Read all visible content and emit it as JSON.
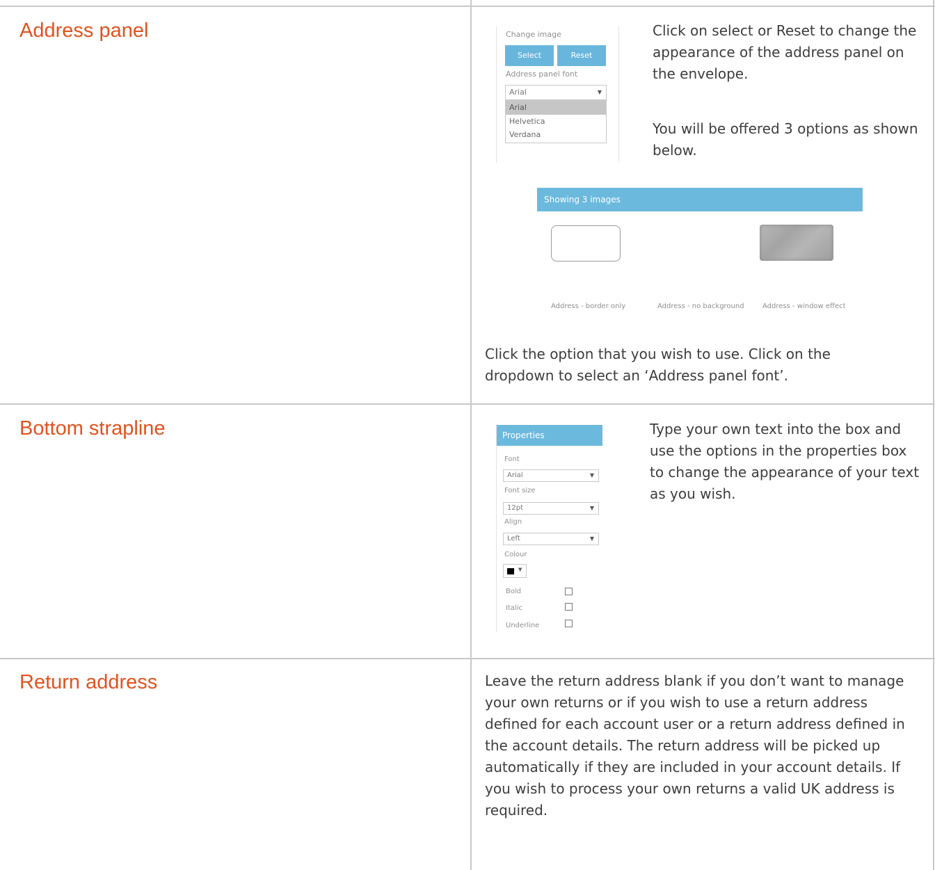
{
  "rows": [
    {
      "title": "Address panel",
      "para1": "Click on select or Reset to change the appearance of the address panel on the envelope.",
      "para2": "You will be offered 3 options as shown below.",
      "footer": "Click the option that you wish to use. Click on the dropdown to select an ‘Address panel font’.",
      "widget": {
        "change_image_label": "Change image",
        "select_label": "Select",
        "reset_label": "Reset",
        "font_label": "Address panel font",
        "font_value": "Arial",
        "font_options": [
          "Arial",
          "Helvetica",
          "Verdana"
        ]
      },
      "images_bar": "Showing 3 images",
      "image_options": [
        "Address - border only",
        "Address - no background",
        "Address - window effect"
      ]
    },
    {
      "title": "Bottom strapline",
      "para1": "Type your own text into the box and use the options in the properties box to change the appearance of your text as you wish.",
      "properties": {
        "header": "Properties",
        "font_label": "Font",
        "font_value": "Arial",
        "size_label": "Font size",
        "size_value": "12pt",
        "align_label": "Align",
        "align_value": "Left",
        "colour_label": "Colour",
        "colour_value": "#000000",
        "bold_label": "Bold",
        "italic_label": "Italic",
        "underline_label": "Underline"
      }
    },
    {
      "title": "Return address",
      "para1": "Leave the return address blank if you don’t want to manage your own returns or if you wish to use a return address defined for each account user or a return address defined in the account details. The return address will be picked up automatically if they are included in your account details. If you wish to process your own returns a valid UK address is required."
    }
  ],
  "colors": {
    "title_orange": "#e0531f",
    "accent_blue": "#69b6dc",
    "grid_line": "#c8c8c8"
  }
}
